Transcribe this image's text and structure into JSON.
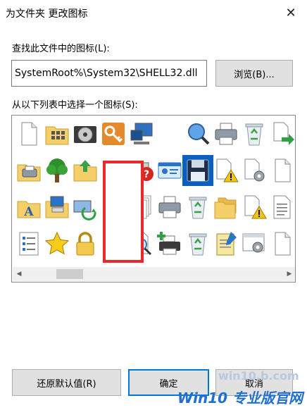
{
  "window": {
    "title": "为文件夹 更改图标",
    "close_glyph": "✕"
  },
  "search": {
    "label": "查找此文件中的图标(L):",
    "value": "SystemRoot%\\System32\\SHELL32.dll",
    "browse_label": "浏览(B)..."
  },
  "icon_list": {
    "label": "从以下列表中选择一个图标(S):",
    "selected_icon": "floppy-disk-icon",
    "icons": [
      "blank-document-icon",
      "folder-apps-icon",
      "cd-drive-icon",
      "key-icon",
      "monitor-network-icon",
      "hidden-icon",
      "magnifier-globe-icon",
      "printer-icon",
      "recycle-bin-icon",
      "document-arrow-icon",
      "printer-folder-icon",
      "tree-icon",
      "folder-up-icon",
      "hidden-icon",
      "help-computer-icon",
      "id-card-icon",
      "floppy-disk-icon",
      "document-warning-icon",
      "document-gear-icon",
      "blank-document-icon",
      "font-folder-icon",
      "computer-folder-icon",
      "network-folder-icon",
      "hidden-icon",
      "documents-stack-icon",
      "printer-icon",
      "recycle-bin-icon",
      "folders-icon",
      "document-warning-icon",
      "text-document-icon",
      "checklist-icon",
      "star-icon",
      "lock-icon",
      "hidden-icon",
      "magnifier-document-icon",
      "printer-add-icon",
      "recycle-bin-icon",
      "notepad-icon",
      "window-gear-icon",
      "blank-document-icon"
    ]
  },
  "footer": {
    "restore_label": "还原默认值(R)",
    "ok_label": "确定",
    "cancel_label": "取消"
  },
  "watermark": {
    "brand": "Win10 专业版官网",
    "url": "win10.b.com"
  },
  "colors": {
    "accent": "#0078d7",
    "selection": "#0a5fc0",
    "redaction": "#e8282a"
  }
}
